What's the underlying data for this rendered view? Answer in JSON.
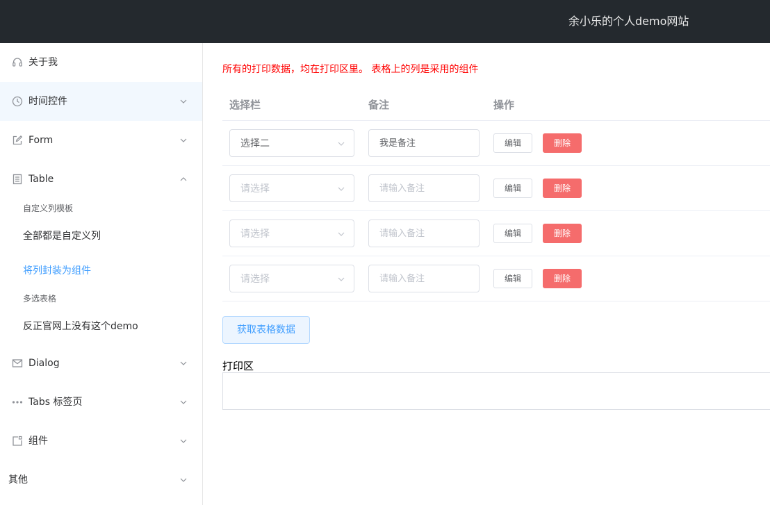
{
  "header": {
    "site_title": "余小乐的个人demo网站"
  },
  "sidebar": {
    "items": [
      {
        "label": "关于我",
        "icon": "headset-icon"
      },
      {
        "label": "时间控件",
        "icon": "clock-icon"
      },
      {
        "label": "Form",
        "icon": "edit-icon"
      },
      {
        "label": "Table",
        "icon": "document-icon"
      },
      {
        "label": "Dialog",
        "icon": "message-icon"
      },
      {
        "label": "Tabs 标签页",
        "icon": "more-icon"
      },
      {
        "label": "组件",
        "icon": "component-icon"
      },
      {
        "label": "其他"
      }
    ],
    "table_sub": [
      {
        "label": "自定义列模板"
      },
      {
        "label": "全部都是自定义列"
      },
      {
        "label": "将列封装为组件"
      },
      {
        "label": "多选表格"
      },
      {
        "label": "反正官网上没有这个demo"
      }
    ]
  },
  "main": {
    "notice": "所有的打印数据，均在打印区里。 表格上的列是采用的组件",
    "columns": [
      "选择栏",
      "备注",
      "操作"
    ],
    "rows": [
      {
        "select_value": "选择二",
        "note_value": "我是备注"
      },
      {
        "select_placeholder": "请选择",
        "note_placeholder": "请输入备注"
      },
      {
        "select_placeholder": "请选择",
        "note_placeholder": "请输入备注"
      },
      {
        "select_placeholder": "请选择",
        "note_placeholder": "请输入备注"
      }
    ],
    "edit_label": "编辑",
    "delete_label": "删除",
    "fetch_button": "获取表格数据",
    "print_label": "打印区"
  },
  "colors": {
    "header_bg": "#24292e",
    "accent": "#409eff",
    "danger": "#f56c6c",
    "notice": "#ff0000"
  }
}
